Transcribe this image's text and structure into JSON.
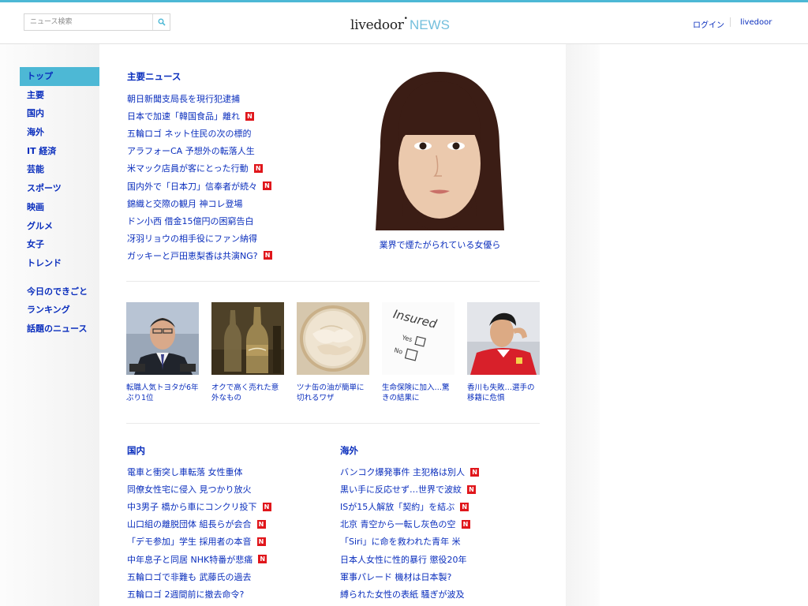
{
  "header": {
    "search_placeholder": "ニュース検索",
    "logo_main": "livedoor",
    "logo_mark": "•",
    "logo_news": "NEWS",
    "login": "ログイン",
    "livedoor_link": "livedoor"
  },
  "sidebar": {
    "items": [
      {
        "label": "トップ"
      },
      {
        "label": "主要"
      },
      {
        "label": "国内"
      },
      {
        "label": "海外"
      },
      {
        "label": "IT 経済"
      },
      {
        "label": "芸能"
      },
      {
        "label": "スポーツ"
      },
      {
        "label": "映画"
      },
      {
        "label": "グルメ"
      },
      {
        "label": "女子"
      },
      {
        "label": "トレンド"
      }
    ],
    "extra": [
      {
        "label": "今日のできごと"
      },
      {
        "label": "ランキング"
      },
      {
        "label": "話題のニュース"
      }
    ]
  },
  "main_news": {
    "title": "主要ニュース",
    "items": [
      {
        "text": "朝日新聞支局長を現行犯逮捕",
        "badge": ""
      },
      {
        "text": "日本で加速「韓国食品」離れ",
        "badge": "N"
      },
      {
        "text": "五輪ロゴ ネット住民の次の標的",
        "badge": ""
      },
      {
        "text": "アラフォーCA 予想外の転落人生",
        "badge": ""
      },
      {
        "text": "米マック店員が客にとった行動",
        "badge": "N"
      },
      {
        "text": "国内外で「日本刀」信奉者が続々",
        "badge": "N"
      },
      {
        "text": "錦織と交際の観月 神コレ登場",
        "badge": ""
      },
      {
        "text": "ドン小西 借金15億円の困窮告白",
        "badge": ""
      },
      {
        "text": "冴羽リョウの相手役にファン納得",
        "badge": ""
      },
      {
        "text": "ガッキーと戸田恵梨香は共演NG?",
        "badge": "N"
      }
    ],
    "feature_caption": "業界で煙たがられている女優ら"
  },
  "thumbs": [
    {
      "caption": "転職人気トヨタが6年ぶり1位",
      "icon": "businessman-photo"
    },
    {
      "caption": "オクで高く売れた意外なもの",
      "icon": "bottle-photo"
    },
    {
      "caption": "ツナ缶の油が簡単に切れるワザ",
      "icon": "tuna-can-photo"
    },
    {
      "caption": "生命保険に加入…驚きの結果に",
      "icon": "insured-form-photo",
      "photo_text": "Insured",
      "yes": "Yes",
      "no": "No"
    },
    {
      "caption": "香川も失敗…選手の移籍に危惧",
      "icon": "soccer-player-photo"
    }
  ],
  "domestic": {
    "title": "国内",
    "items": [
      {
        "text": "電車と衝突し車転落 女性重体",
        "badge": ""
      },
      {
        "text": "同僚女性宅に侵入 見つかり放火",
        "badge": ""
      },
      {
        "text": "中3男子 橋から車にコンクリ投下",
        "badge": "N"
      },
      {
        "text": "山口組の離脱団体 組長らが会合",
        "badge": "N"
      },
      {
        "text": "「デモ参加」学生 採用者の本音",
        "badge": "N"
      },
      {
        "text": "中年息子と同居 NHK特番が悲痛",
        "badge": "N"
      },
      {
        "text": "五輪ロゴで非難も 武藤氏の過去",
        "badge": ""
      },
      {
        "text": "五輪ロゴ 2週間前に撤去命令?",
        "badge": ""
      }
    ]
  },
  "overseas": {
    "title": "海外",
    "items": [
      {
        "text": "バンコク爆発事件 主犯格は別人",
        "badge": "N"
      },
      {
        "text": "黒い手に反応せず…世界で波紋",
        "badge": "N"
      },
      {
        "text": "ISが15人解放「契約」を結ぶ",
        "badge": "N"
      },
      {
        "text": "北京 青空から一転し灰色の空",
        "badge": "N"
      },
      {
        "text": "「Siri」に命を救われた青年 米",
        "badge": ""
      },
      {
        "text": "日本人女性に性的暴行 懲役20年",
        "badge": ""
      },
      {
        "text": "軍事パレード 機材は日本製?",
        "badge": ""
      },
      {
        "text": "縛られた女性の表紙 騒ぎが波及",
        "badge": ""
      }
    ]
  },
  "colors": {
    "accent": "#4db8d5",
    "link": "#0a2ebd",
    "badge": "#e0161b"
  }
}
